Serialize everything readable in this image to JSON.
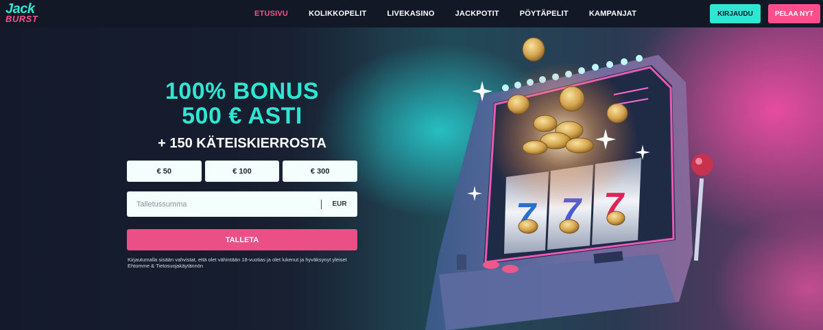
{
  "logo": {
    "line1": "Jack",
    "line2": "BURST"
  },
  "nav": {
    "items": [
      {
        "label": "ETUSIVU",
        "active": true
      },
      {
        "label": "KOLIKKOPELIT",
        "active": false
      },
      {
        "label": "LIVEKASINO",
        "active": false
      },
      {
        "label": "JACKPOTIT",
        "active": false
      },
      {
        "label": "PÖYTÄPELIT",
        "active": false
      },
      {
        "label": "KAMPANJAT",
        "active": false
      }
    ]
  },
  "header": {
    "login_label": "KIRJAUDU",
    "play_label": "PELAA NYT"
  },
  "offer": {
    "headline_line1": "100% BONUS",
    "headline_line2": "500 € ASTI",
    "subheadline": "+ 150 KÄTEISKIERROSTA",
    "amounts": [
      "€ 50",
      "€ 100",
      "€ 300"
    ],
    "deposit_placeholder": "Talletussumma",
    "currency": "EUR",
    "deposit_button": "TALLETA",
    "disclaimer": "Kirjautumalla sisään vahvistat, että olet vähintään 18-vuotias ja olet lukenut ja hyväksynyt yleiset Ehtomme & Tietosuojakäytännön"
  },
  "colors": {
    "accent_teal": "#2ee6d2",
    "accent_pink": "#ff4f8b",
    "background": "#141a2b"
  },
  "illustration": {
    "reels": [
      "7",
      "7",
      "7"
    ]
  }
}
